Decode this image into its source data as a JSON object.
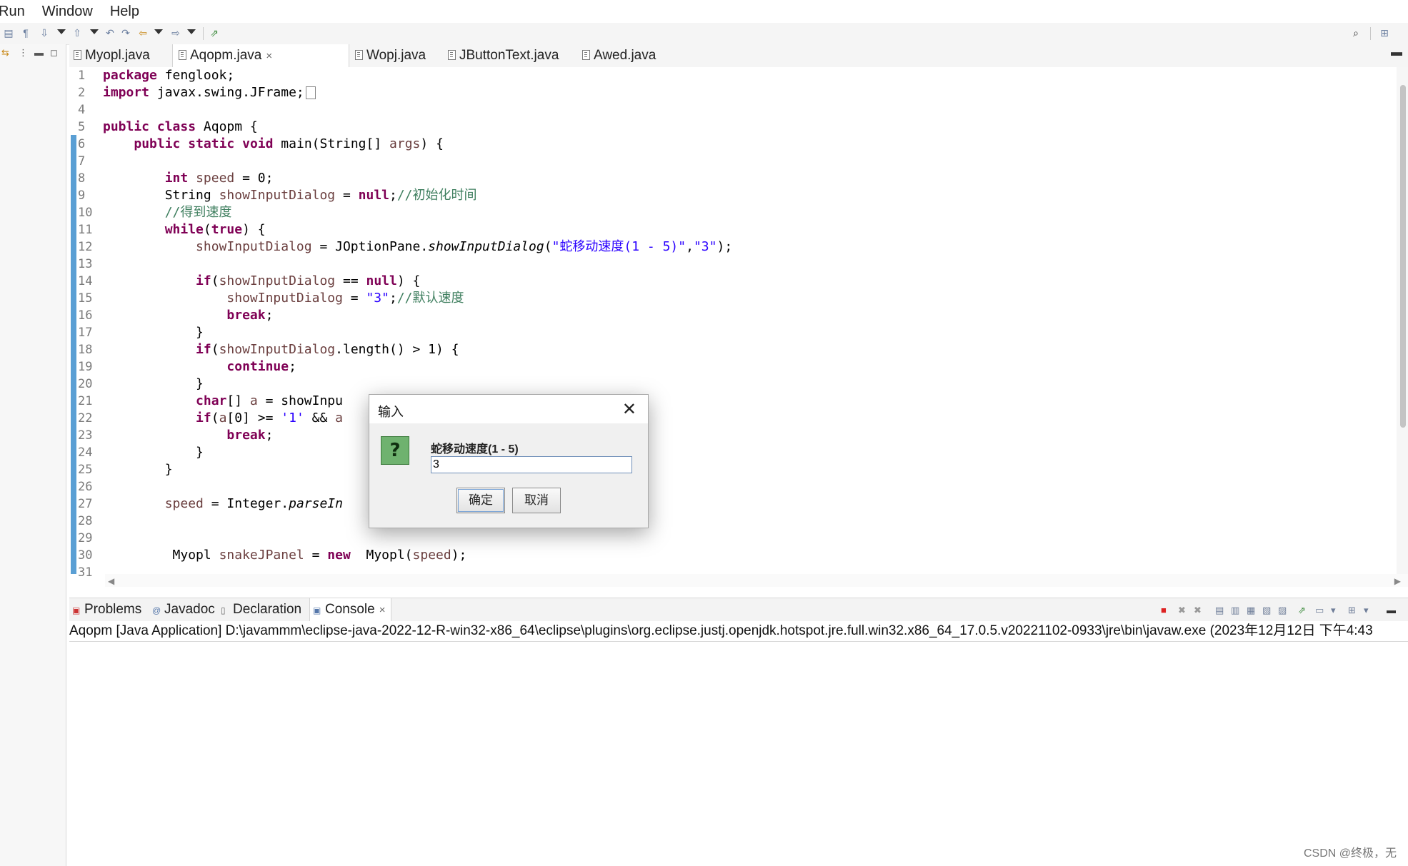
{
  "menu": [
    "Run",
    "Window",
    "Help"
  ],
  "editor_tabs": [
    {
      "label": "Myopl.java",
      "active": false
    },
    {
      "label": "Aqopm.java",
      "active": true,
      "close": "×"
    },
    {
      "label": "Wopj.java",
      "active": false
    },
    {
      "label": "JButtonText.java",
      "active": false
    },
    {
      "label": "Awed.java",
      "active": false
    }
  ],
  "code": {
    "line_numbers": [
      "1",
      "2",
      "4",
      "5",
      "6",
      "7",
      "8",
      "9",
      "10",
      "11",
      "12",
      "13",
      "14",
      "15",
      "16",
      "17",
      "18",
      "19",
      "20",
      "21",
      "22",
      "23",
      "24",
      "25",
      "26",
      "27",
      "28",
      "29",
      "30",
      "31"
    ],
    "lines": [
      "package fenglook;",
      "import javax.swing.JFrame;",
      "",
      "public class Aqopm {",
      "    public static void main(String[] args) {",
      "",
      "        int speed = 0;",
      "        String showInputDialog = null;//初始化时间",
      "        //得到速度",
      "        while(true) {",
      "            showInputDialog = JOptionPane.showInputDialog(\"蛇移动速度(1 - 5)\",\"3\");",
      "",
      "            if(showInputDialog == null) {",
      "                showInputDialog = \"3\";//默认速度",
      "                break;",
      "            }",
      "            if(showInputDialog.length() > 1) {",
      "                continue;",
      "            }",
      "            char[] a = showInpu",
      "            if(a[0] >= '1' && a",
      "                break;",
      "            }",
      "        }",
      "",
      "        speed = Integer.parseIn",
      "",
      "",
      "         Myopl snakeJPanel = new  Myopl(speed);",
      ""
    ]
  },
  "view_tabs": [
    {
      "label": "Problems",
      "icon": "problems-icon",
      "active": false
    },
    {
      "label": "Javadoc",
      "icon": "javadoc-icon",
      "active": false
    },
    {
      "label": "Declaration",
      "icon": "declaration-icon",
      "active": false
    },
    {
      "label": "Console",
      "icon": "console-icon",
      "active": true,
      "close": "×"
    }
  ],
  "console": {
    "header": "Aqopm [Java Application] D:\\javammm\\eclipse-java-2022-12-R-win32-x86_64\\eclipse\\plugins\\org.eclipse.justj.openjdk.hotspot.jre.full.win32.x86_64_17.0.5.v20221102-0933\\jre\\bin\\javaw.exe  (2023年12月12日 下午4:43"
  },
  "dialog": {
    "title": "输入",
    "close": "✕",
    "icon": "question-icon",
    "icon_glyph": "?",
    "message": "蛇移动速度(1 - 5)",
    "input_value": "3",
    "ok_label": "确定",
    "cancel_label": "取消"
  },
  "watermark": "CSDN @终极，无",
  "colors": {
    "keyword": "#7f0055",
    "variable": "#6a3e3e",
    "string": "#2a00ff",
    "comment": "#3f7f5f",
    "change_bar": "#5a9fd4"
  }
}
